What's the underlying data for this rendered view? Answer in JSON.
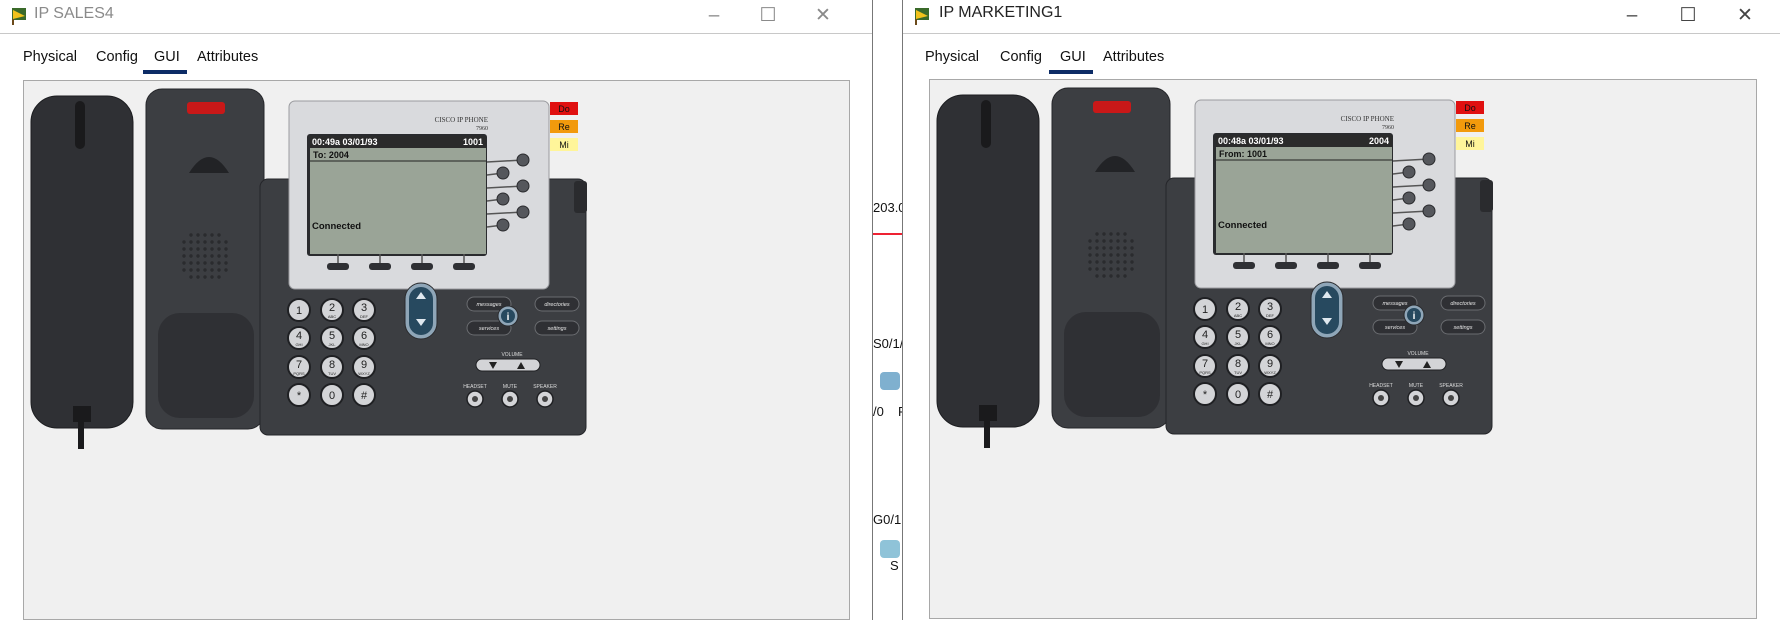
{
  "background": {
    "fragments": [
      "203.0",
      "S0/1/",
      "/0",
      "F",
      "G0/1",
      "S"
    ]
  },
  "windows": [
    {
      "id": "left",
      "title": "IP SALES4",
      "tabs": [
        "Physical",
        "Config",
        "GUI",
        "Attributes"
      ],
      "active_tab": "GUI",
      "phone": {
        "brand": "CISCO IP PHONE",
        "model": "7960",
        "lcd_time": "00:49a 03/01/93",
        "lcd_ext": "1001",
        "lcd_line": "To: 2004",
        "lcd_state": "Connected",
        "lamps": [
          "Do",
          "Re",
          "Mi"
        ],
        "softkeys": [
          "messages",
          "directories",
          "services",
          "settings"
        ],
        "volume_label": "VOLUME",
        "audio_labels": [
          "HEADSET",
          "MUTE",
          "SPEAKER"
        ]
      }
    },
    {
      "id": "right",
      "title": "IP MARKETING1",
      "tabs": [
        "Physical",
        "Config",
        "GUI",
        "Attributes"
      ],
      "active_tab": "GUI",
      "phone": {
        "brand": "CISCO IP PHONE",
        "model": "7960",
        "lcd_time": "00:48a 03/01/93",
        "lcd_ext": "2004",
        "lcd_line": "From: 1001",
        "lcd_state": "Connected",
        "lamps": [
          "Do",
          "Re",
          "Mi"
        ],
        "softkeys": [
          "messages",
          "directories",
          "services",
          "settings"
        ],
        "volume_label": "VOLUME",
        "audio_labels": [
          "HEADSET",
          "MUTE",
          "SPEAKER"
        ]
      }
    }
  ],
  "keypad": [
    [
      "1",
      ""
    ],
    [
      "2",
      "ABC"
    ],
    [
      "3",
      "DEF"
    ],
    [
      "4",
      "GHI"
    ],
    [
      "5",
      "JKL"
    ],
    [
      "6",
      "MNO"
    ],
    [
      "7",
      "PQRS"
    ],
    [
      "8",
      "TUV"
    ],
    [
      "9",
      "WXYZ"
    ],
    [
      "*",
      ""
    ],
    [
      "0",
      ""
    ],
    [
      "#",
      ""
    ]
  ],
  "window_controls": [
    "minimize-button",
    "maximize-button",
    "close-button"
  ],
  "colors": {
    "lamp_do": "#e01010",
    "lamp_re": "#f29a0c",
    "lamp_mi": "#fff59a",
    "tab_underline": "#0d2c66",
    "phone_body": "#3c3e42",
    "lcd": "#9aa497"
  }
}
